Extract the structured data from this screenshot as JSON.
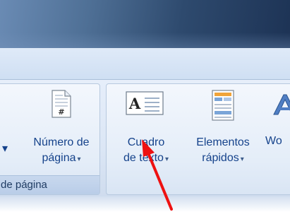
{
  "ribbon": {
    "left_group": {
      "label": "de página",
      "cut_caret": "▾",
      "page_number_button": {
        "line1": "Número de",
        "line2": "página",
        "caret": "▾",
        "icon": "page-number-icon",
        "icon_glyph": "#"
      }
    },
    "right_group": {
      "text_box_button": {
        "line1": "Cuadro",
        "line2": "de texto",
        "caret": "▾",
        "icon": "text-box-icon",
        "icon_glyph": "A"
      },
      "quick_parts_button": {
        "line1": "Elementos",
        "line2": "rápidos",
        "caret": "▾",
        "icon": "quick-parts-icon"
      },
      "wordart_button": {
        "line1": "Wo",
        "icon": "wordart-icon"
      }
    }
  },
  "annotation": {
    "arrow_color": "#ee1111"
  },
  "colors": {
    "label_text": "#15428b",
    "group_border": "#b7c9df"
  }
}
